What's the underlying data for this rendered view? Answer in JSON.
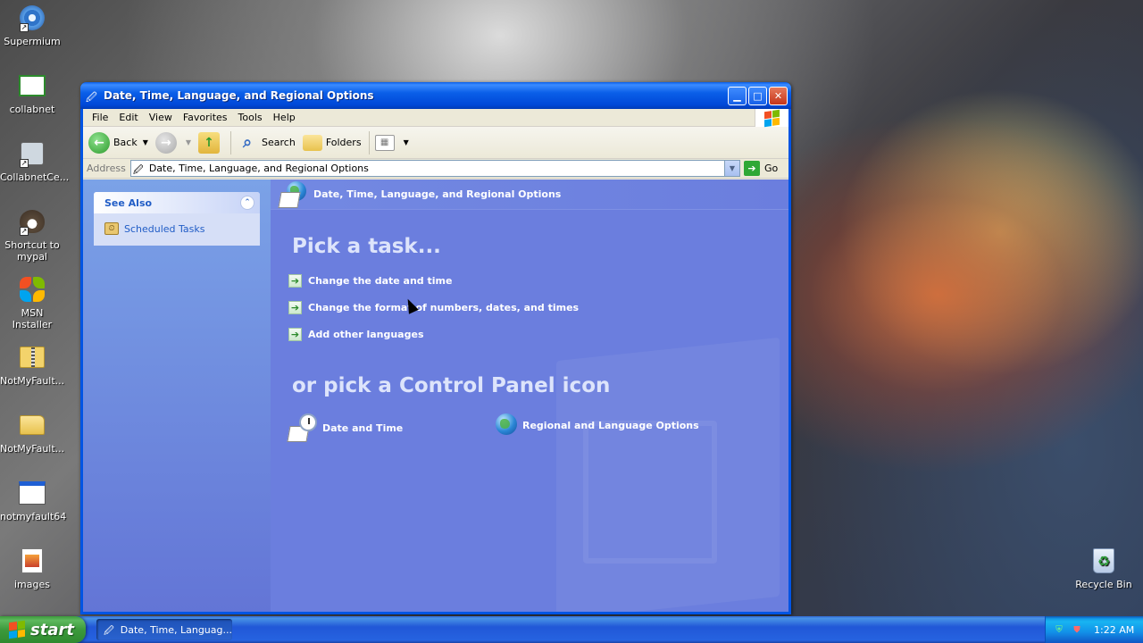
{
  "desktop": {
    "icons": [
      {
        "label": "Supermium",
        "icon": "supermium-icon"
      },
      {
        "label": "collabnet",
        "icon": "collabnet-icon"
      },
      {
        "label": "CollabnetCe...",
        "icon": "collabnet-certificate-icon"
      },
      {
        "label": "Shortcut to mypal",
        "icon": "mypal-icon"
      },
      {
        "label": "MSN Installer",
        "icon": "msn-butterfly-icon"
      },
      {
        "label": "NotMyFault...",
        "icon": "zip-folder-icon"
      },
      {
        "label": "NotMyFault...",
        "icon": "folder-icon"
      },
      {
        "label": "notmyfault64",
        "icon": "application-window-icon"
      },
      {
        "label": "images",
        "icon": "image-file-icon"
      }
    ],
    "recycle_bin": {
      "label": "Recycle Bin",
      "icon": "recycle-bin-icon"
    }
  },
  "window": {
    "title": "Date, Time, Language, and Regional Options",
    "menu": [
      "File",
      "Edit",
      "View",
      "Favorites",
      "Tools",
      "Help"
    ],
    "toolbar": {
      "back": "Back",
      "search": "Search",
      "folders": "Folders"
    },
    "address": {
      "label": "Address",
      "value": "Date, Time, Language, and Regional Options",
      "go": "Go"
    },
    "sidebar": {
      "see_also_title": "See Also",
      "links": [
        "Scheduled Tasks"
      ]
    },
    "main": {
      "header": "Date, Time, Language, and Regional Options",
      "pick_task_heading": "Pick a task...",
      "tasks": [
        "Change the date and time",
        "Change the format of numbers, dates, and times",
        "Add other languages"
      ],
      "or_pick_heading": "or pick a Control Panel icon",
      "cp_icons": [
        "Date and Time",
        "Regional and Language Options"
      ]
    }
  },
  "taskbar": {
    "start_label": "start",
    "task_button": "Date, Time, Languag...",
    "clock": "1:22 AM"
  },
  "colors": {
    "window_blue": "#0054e3",
    "sidepane": "#7ba2e7",
    "mainpane": "#6b7ede",
    "start_green": "#3c9a3c",
    "taskbar_blue": "#2157d7"
  }
}
